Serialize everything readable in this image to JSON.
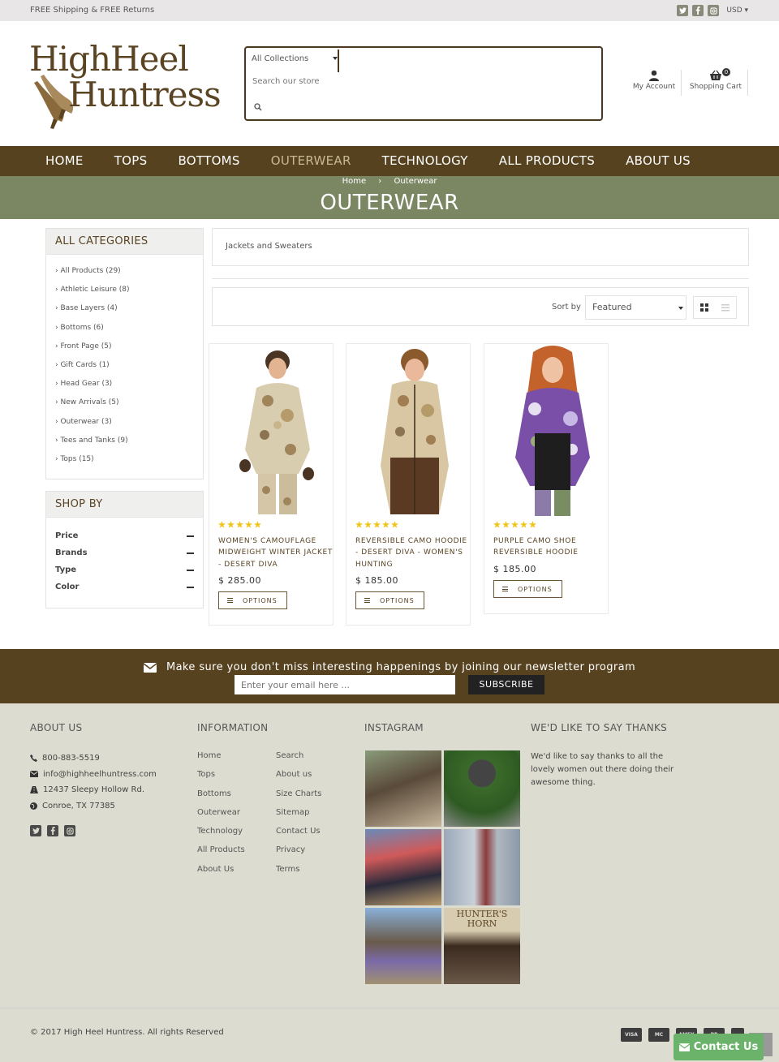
{
  "topbar": {
    "promo": "FREE Shipping & FREE Returns",
    "currency": "USD ▾",
    "social_icons": [
      "twitter-icon",
      "facebook-icon",
      "instagram-icon"
    ]
  },
  "header": {
    "logo_line1": "HighHeel",
    "logo_line2": "Huntress",
    "search": {
      "collection": "All Collections",
      "placeholder": "Search our store"
    },
    "account_label": "My Account",
    "cart_label": "Shopping Cart",
    "cart_count": "0"
  },
  "nav": {
    "items": [
      "HOME",
      "TOPS",
      "BOTTOMS",
      "OUTERWEAR",
      "TECHNOLOGY",
      "ALL PRODUCTS",
      "ABOUT US"
    ],
    "active": "OUTERWEAR"
  },
  "banner": {
    "breadcrumb": [
      "Home",
      "›",
      "Outerwear"
    ],
    "title": "OUTERWEAR"
  },
  "sidebar": {
    "categories_title": "ALL CATEGORIES",
    "categories": [
      "› All Products (29)",
      "› Athletic Leisure (8)",
      "› Base Layers (4)",
      "› Bottoms (6)",
      "› Front Page (5)",
      "› Gift Cards (1)",
      "› Head Gear (3)",
      "› New Arrivals (5)",
      "› Outerwear (3)",
      "› Tees and Tanks (9)",
      "› Tops (15)"
    ],
    "shopby_title": "SHOP BY",
    "filters": [
      "Price",
      "Brands",
      "Type",
      "Color"
    ]
  },
  "main": {
    "subcategory": "Jackets and Sweaters",
    "sort_label": "Sort by",
    "sort_value": "Featured",
    "products": [
      {
        "title": "WOMEN'S CAMOUFLAGE MIDWEIGHT WINTER JACKET - DESERT DIVA",
        "price": "$ 285.00",
        "rating": 5,
        "button": "OPTIONS"
      },
      {
        "title": "REVERSIBLE CAMO HOODIE - DESERT DIVA - WOMEN'S HUNTING",
        "price": "$ 185.00",
        "rating": 5,
        "button": "OPTIONS"
      },
      {
        "title": "PURPLE CAMO SHOE REVERSIBLE HOODIE",
        "price": "$ 185.00",
        "rating": 5,
        "button": "OPTIONS"
      }
    ]
  },
  "newsletter": {
    "message": "Make sure you don't miss interesting happenings by joining our newsletter program",
    "placeholder": "Enter your email here ...",
    "button": "SUBSCRIBE"
  },
  "footer": {
    "about_title": "ABOUT US",
    "phone": "800-883-5519",
    "email": "info@highheelhuntress.com",
    "address1": "12437 Sleepy Hollow Rd.",
    "address2": "Conroe, TX 77385",
    "info_title": "INFORMATION",
    "info_links_left": [
      "Home",
      "Tops",
      "Bottoms",
      "Outerwear",
      "Technology",
      "All Products",
      "About Us"
    ],
    "info_links_right": [
      "Search",
      "About us",
      "Size Charts",
      "Sitemap",
      "Contact Us",
      "Privacy",
      "Terms"
    ],
    "instagram_title": "INSTAGRAM",
    "insta_text": "HUNTER'S HORN",
    "thanks_title": "WE'D LIKE TO SAY THANKS",
    "thanks_text": "We'd like to say thanks to all the lovely women out there doing their awesome thing.",
    "copyright": "© 2017 High Heel Huntress. All rights Reserved",
    "payments": [
      "VISA",
      "MC",
      "AMEX",
      "PP",
      ""
    ],
    "contact_button": "Contact Us"
  },
  "colors": {
    "brand_brown": "#57421f",
    "banner_green": "#7b8662",
    "footer_bg": "#dcdcd0",
    "star": "#f0c419"
  }
}
